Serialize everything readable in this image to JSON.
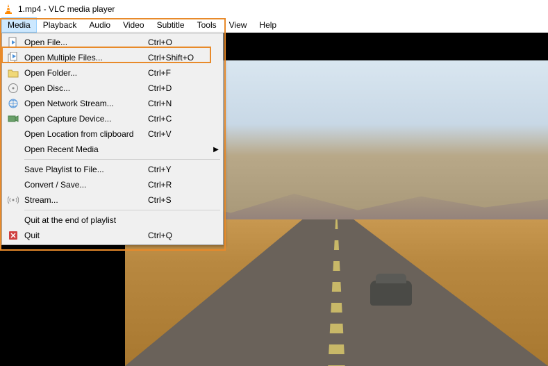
{
  "window": {
    "title": "1.mp4 - VLC media player"
  },
  "menubar": {
    "items": [
      "Media",
      "Playback",
      "Audio",
      "Video",
      "Subtitle",
      "Tools",
      "View",
      "Help"
    ],
    "active": "Media"
  },
  "dropdown": {
    "items": [
      {
        "icon": "file-play",
        "label": "Open File...",
        "shortcut": "Ctrl+O",
        "submenu": false
      },
      {
        "icon": "files-play",
        "label": "Open Multiple Files...",
        "shortcut": "Ctrl+Shift+O",
        "submenu": false,
        "highlighted": true
      },
      {
        "icon": "folder",
        "label": "Open Folder...",
        "shortcut": "Ctrl+F",
        "submenu": false
      },
      {
        "icon": "disc",
        "label": "Open Disc...",
        "shortcut": "Ctrl+D",
        "submenu": false
      },
      {
        "icon": "network",
        "label": "Open Network Stream...",
        "shortcut": "Ctrl+N",
        "submenu": false
      },
      {
        "icon": "capture",
        "label": "Open Capture Device...",
        "shortcut": "Ctrl+C",
        "submenu": false
      },
      {
        "icon": "",
        "label": "Open Location from clipboard",
        "shortcut": "Ctrl+V",
        "submenu": false
      },
      {
        "icon": "",
        "label": "Open Recent Media",
        "shortcut": "",
        "submenu": true
      },
      {
        "separator": true
      },
      {
        "icon": "",
        "label": "Save Playlist to File...",
        "shortcut": "Ctrl+Y",
        "submenu": false
      },
      {
        "icon": "",
        "label": "Convert / Save...",
        "shortcut": "Ctrl+R",
        "submenu": false
      },
      {
        "icon": "stream",
        "label": "Stream...",
        "shortcut": "Ctrl+S",
        "submenu": false
      },
      {
        "separator": true
      },
      {
        "icon": "",
        "label": "Quit at the end of playlist",
        "shortcut": "",
        "submenu": false
      },
      {
        "icon": "quit",
        "label": "Quit",
        "shortcut": "Ctrl+Q",
        "submenu": false
      }
    ]
  }
}
